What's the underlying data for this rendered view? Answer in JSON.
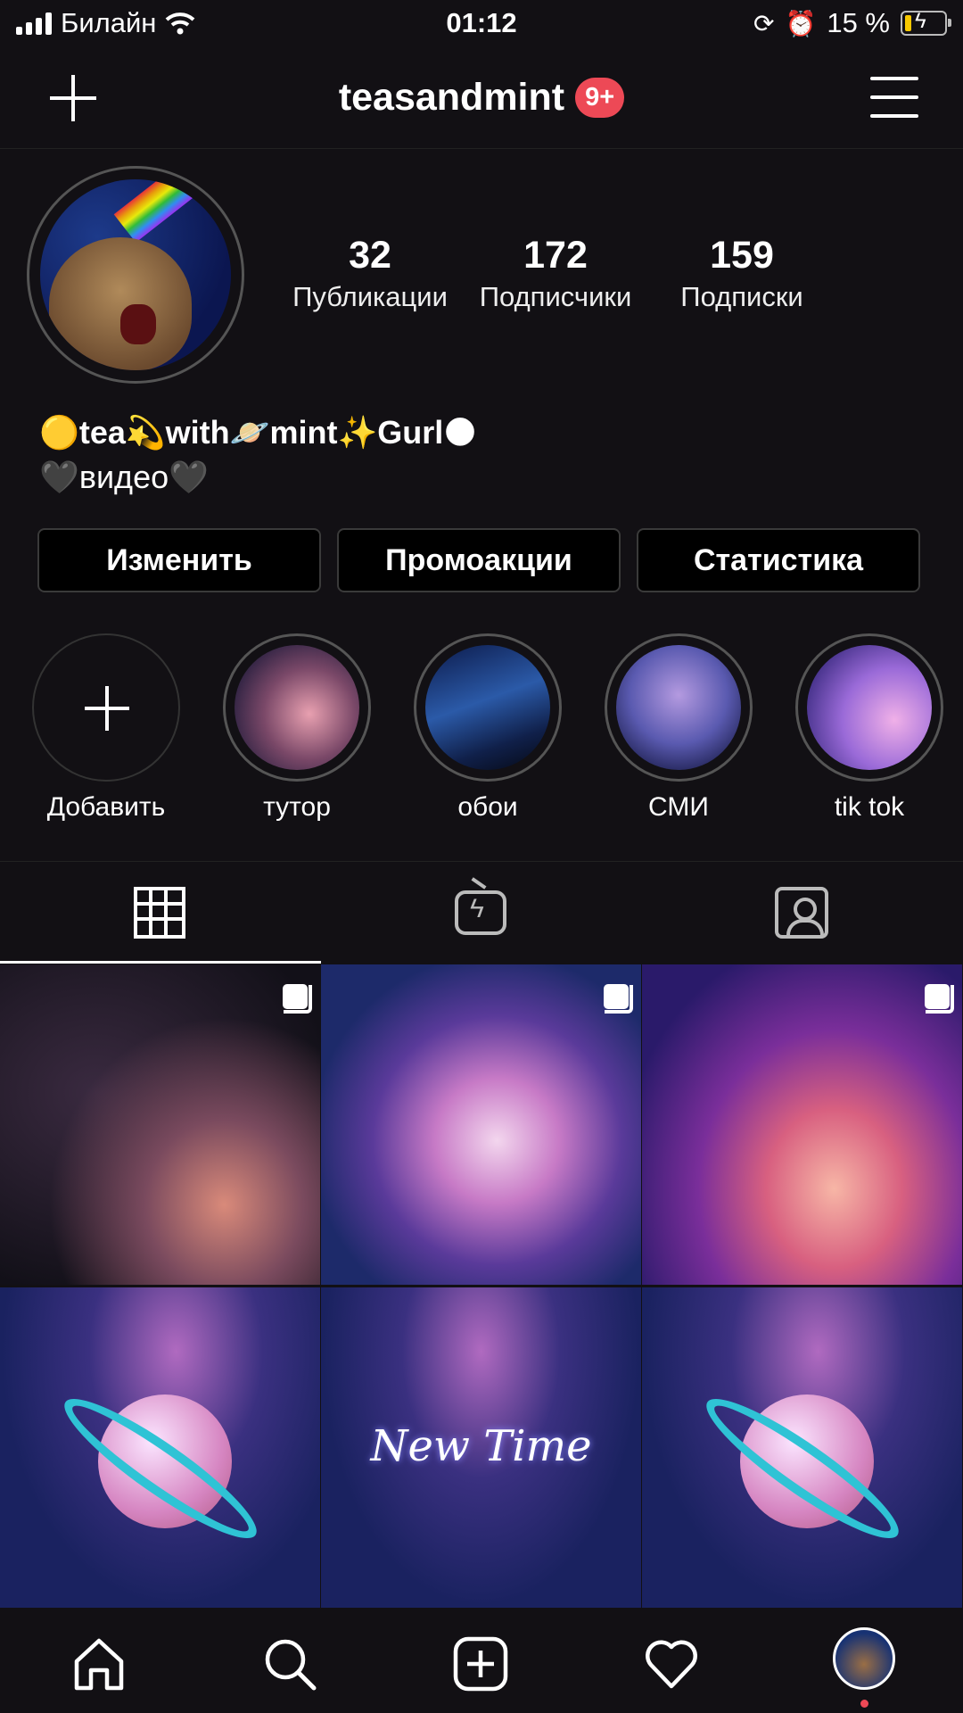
{
  "status_bar": {
    "carrier": "Билайн",
    "time": "01:12",
    "battery": "15 %"
  },
  "header": {
    "username": "teasandmint",
    "notification_badge": "9+"
  },
  "profile": {
    "stats": [
      {
        "value": "32",
        "label": "Публикации"
      },
      {
        "value": "172",
        "label": "Подписчики"
      },
      {
        "value": "159",
        "label": "Подписки"
      }
    ],
    "bio_line1": "🟡tea💫with🪐mint✨Gurl🌑",
    "bio_line2": "🖤видео🖤"
  },
  "buttons": {
    "edit": "Изменить",
    "promo": "Промоакции",
    "stats": "Статистика"
  },
  "highlights": [
    {
      "label": "Добавить"
    },
    {
      "label": "тутор"
    },
    {
      "label": "обои"
    },
    {
      "label": "СМИ"
    },
    {
      "label": "tik tok"
    }
  ],
  "posts": {
    "caption_5": "New Time"
  },
  "colors": {
    "accent": "#ed4956",
    "background": "#121014"
  }
}
